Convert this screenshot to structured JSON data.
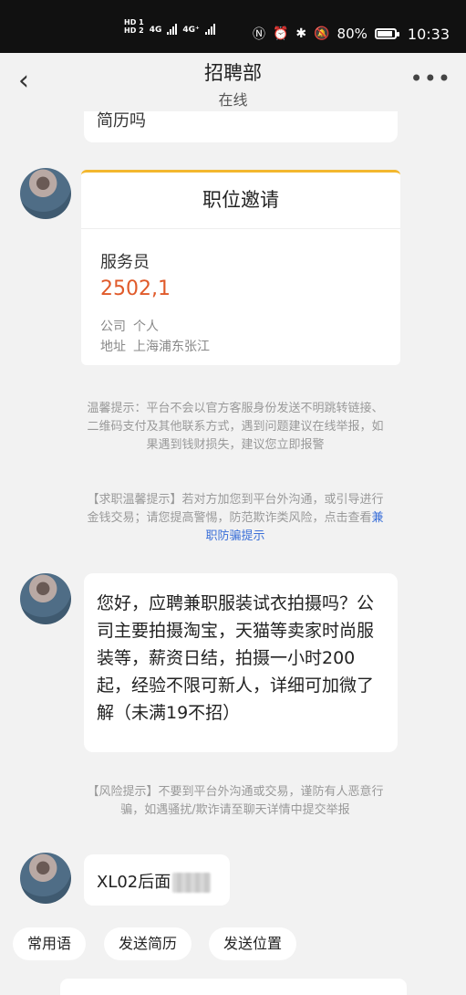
{
  "status_bar": {
    "sim1": "HD 1",
    "sim2": "HD 2",
    "net1": "4G",
    "net2": "4G⁺",
    "battery": "80%",
    "time": "10:33",
    "icons": [
      "nfc-icon",
      "alarm-icon",
      "bluetooth-icon",
      "mute-icon"
    ]
  },
  "header": {
    "title": "招聘部",
    "subtitle": "在线",
    "back_icon": "‹",
    "more_icon": "•••"
  },
  "messages": {
    "top_partial": "简历吗",
    "job_card": {
      "heading": "职位邀请",
      "job": "服务员",
      "salary": "2502,1",
      "company_label": "公司",
      "company_value": "个人",
      "address_label": "地址",
      "address_value": "上海浦东张江"
    },
    "notice1": "温馨提示：平台不会以官方客服身份发送不明跳转链接、二维码支付及其他联系方式，遇到问题建议在线举报，如果遇到钱财损失，建议您立即报警",
    "notice2_prefix": "【求职温馨提示】若对方加您到平台外沟通，或引导进行金钱交易；请您提高警惕，防范欺诈类风险，点击查看",
    "notice2_link": "兼职防骗提示",
    "main_message": "您好，应聘兼职服装试衣拍摄吗？公司主要拍摄淘宝，天猫等卖家时尚服装等，薪资日结，拍摄一小时200起，经验不限可新人，详细可加微了解（未满19不招）",
    "notice3": "【风险提示】不要到平台外沟通或交易，谨防有人恶意行骗，如遇骚扰/欺诈请至聊天详情中提交举报",
    "last_message": "XL02后面"
  },
  "quick_actions": [
    "常用语",
    "发送简历",
    "发送位置"
  ]
}
